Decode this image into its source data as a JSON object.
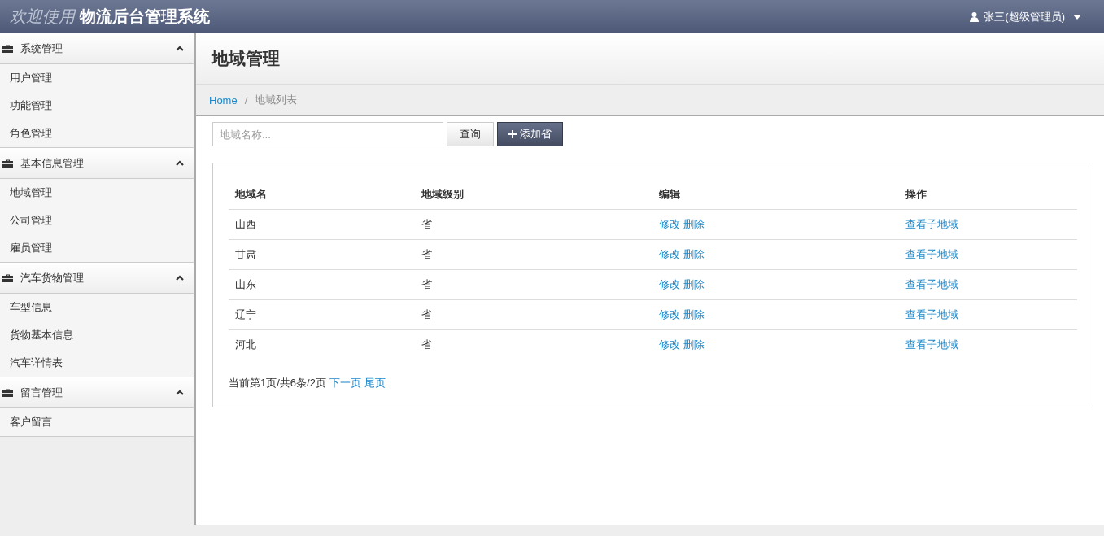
{
  "header": {
    "welcome": "欢迎使用",
    "title": "物流后台管理系统",
    "user": "张三(超级管理员)"
  },
  "sidebar": {
    "groups": [
      {
        "label": "系统管理",
        "expanded": true,
        "items": [
          "用户管理",
          "功能管理",
          "角色管理"
        ]
      },
      {
        "label": "基本信息管理",
        "expanded": true,
        "items": [
          "地域管理",
          "公司管理",
          "雇员管理"
        ]
      },
      {
        "label": "汽车货物管理",
        "expanded": true,
        "items": [
          "车型信息",
          "货物基本信息",
          "汽车详情表"
        ]
      },
      {
        "label": "留言管理",
        "expanded": true,
        "items": [
          "客户留言"
        ]
      }
    ]
  },
  "page_title": "地域管理",
  "breadcrumb": [
    {
      "label": "Home",
      "kind": "link"
    },
    {
      "label": "/",
      "kind": "separator"
    },
    {
      "label": "地域列表",
      "kind": "current"
    }
  ],
  "search": {
    "placeholder": "地域名称...",
    "query_button": "查询",
    "add_button": "添加省"
  },
  "table": {
    "columns": [
      "地域名",
      "地域级别",
      "编辑",
      "操作"
    ],
    "rows": [
      {
        "name": "山西",
        "level": "省",
        "edit": "修改",
        "delete": "删除",
        "action": "查看子地域"
      },
      {
        "name": "甘肃",
        "level": "省",
        "edit": "修改",
        "delete": "删除",
        "action": "查看子地域"
      },
      {
        "name": "山东",
        "level": "省",
        "edit": "修改",
        "delete": "删除",
        "action": "查看子地域"
      },
      {
        "name": "辽宁",
        "level": "省",
        "edit": "修改",
        "delete": "删除",
        "action": "查看子地域"
      },
      {
        "name": "河北",
        "level": "省",
        "edit": "修改",
        "delete": "删除",
        "action": "查看子地域"
      }
    ]
  },
  "pagination": {
    "summary": "当前第1页/共6条/2页",
    "next": "下一页",
    "last": "尾页"
  }
}
